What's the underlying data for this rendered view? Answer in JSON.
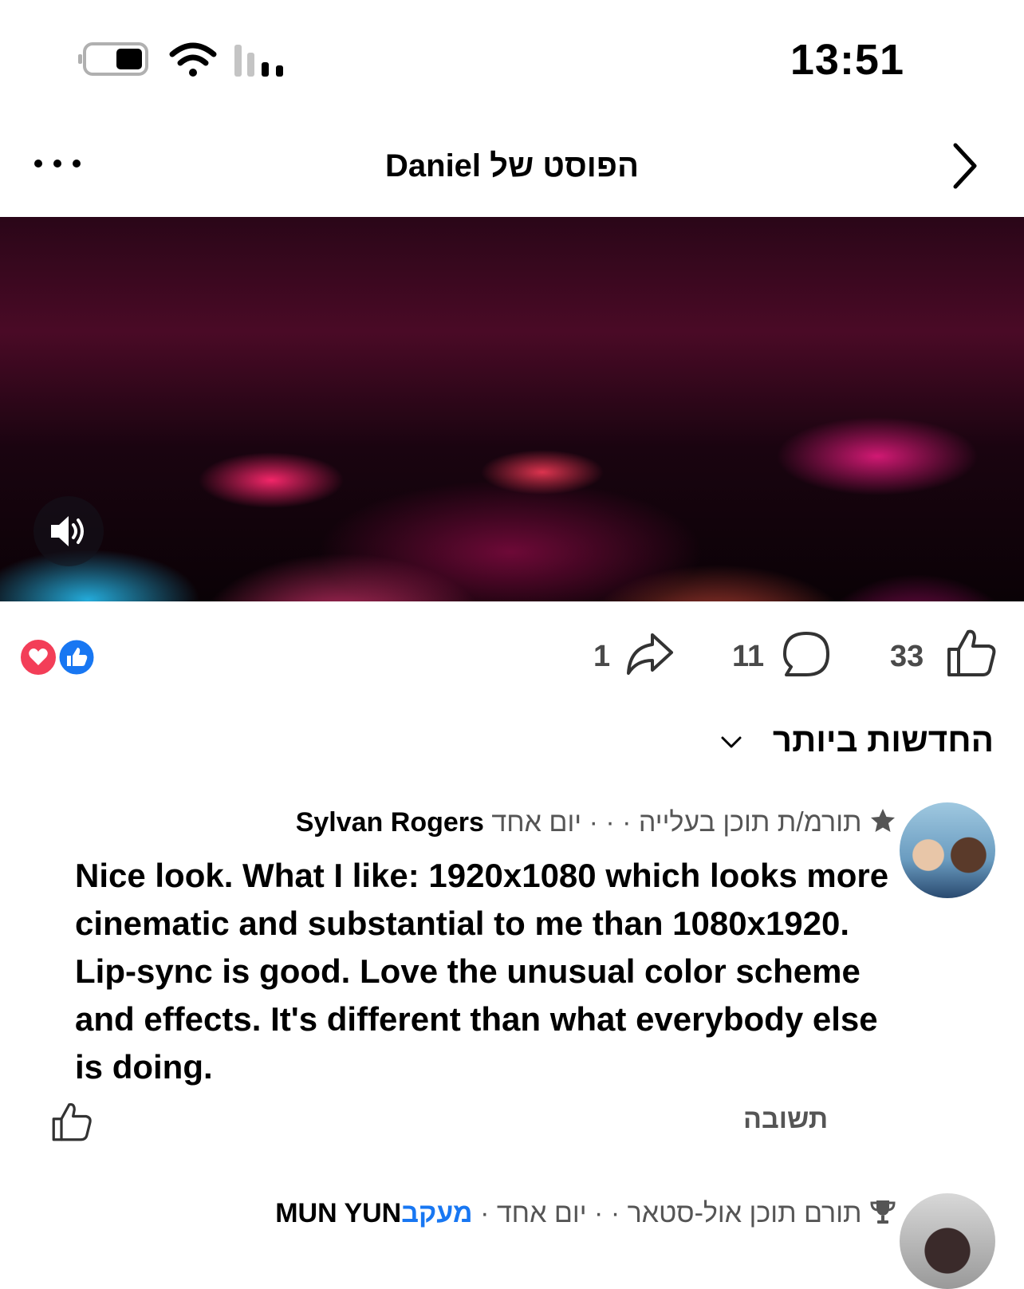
{
  "status_bar": {
    "time": "13:51"
  },
  "header": {
    "title": "הפוסט של Daniel"
  },
  "actions": {
    "likes": "33",
    "comments": "11",
    "shares": "1"
  },
  "reaction_icons": [
    "like",
    "love"
  ],
  "sort": {
    "label": "החדשות ביותר"
  },
  "comments": [
    {
      "badge": "תורמ/ת תוכן בעלייה",
      "separator": "· · ·",
      "time": "יום אחד",
      "author": "Sylvan Rogers",
      "text": "Nice look. What I like: 1920x1080 which looks more cinematic and substantial to me than 1080x1920. Lip-sync is good. Love the unusual color scheme and effects. It's different than what everybody else is doing.",
      "reply": "תשובה"
    },
    {
      "badge": "תורם תוכן אול-סטאר",
      "separator": "· ·",
      "time": "יום אחד",
      "dot": "·",
      "follow": "מעקב",
      "author": "MUN YUN"
    }
  ],
  "colors": {
    "accent": "#1877f2",
    "love": "#f33e58"
  }
}
